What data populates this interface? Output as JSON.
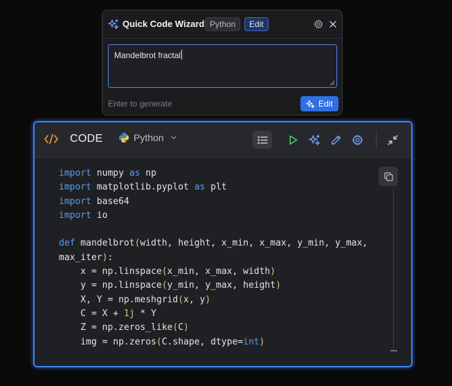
{
  "wizard": {
    "title": "Quick Code Wizard",
    "language_chip": "Python",
    "mode_chip": "Edit",
    "prompt_value": "Mandelbrot fractal",
    "hint": "Enter to generate",
    "generate_label": "Edit",
    "icons": [
      "sparkle-icon",
      "gear-icon",
      "close-icon"
    ]
  },
  "codeblock": {
    "title": "CODE",
    "language": "Python",
    "accent_color": "#3b82f6",
    "toolbar_icons": [
      "list-icon",
      "run-icon",
      "sparkle-icon",
      "pencil-icon",
      "gear-icon",
      "collapse-icon"
    ],
    "lines": [
      [
        [
          "kw",
          "import"
        ],
        [
          "t",
          " numpy "
        ],
        [
          "kw",
          "as"
        ],
        [
          "t",
          " np"
        ]
      ],
      [
        [
          "kw",
          "import"
        ],
        [
          "t",
          " matplotlib.pyplot "
        ],
        [
          "kw",
          "as"
        ],
        [
          "t",
          " plt"
        ]
      ],
      [
        [
          "kw",
          "import"
        ],
        [
          "t",
          " base64"
        ]
      ],
      [
        [
          "kw",
          "import"
        ],
        [
          "t",
          " io"
        ]
      ],
      [],
      [
        [
          "kw",
          "def"
        ],
        [
          "t",
          " mandelbrot"
        ],
        [
          "br",
          "("
        ],
        [
          "t",
          "width, height, x_min, x_max, y_min, y_max,"
        ]
      ],
      [
        [
          "t",
          "max_iter"
        ],
        [
          "br",
          ")"
        ],
        [
          "t",
          ":"
        ]
      ],
      [
        [
          "t",
          "    x = np.linspace"
        ],
        [
          "br",
          "("
        ],
        [
          "t",
          "x_min, x_max, width"
        ],
        [
          "br",
          ")"
        ]
      ],
      [
        [
          "t",
          "    y = np.linspace"
        ],
        [
          "br",
          "("
        ],
        [
          "t",
          "y_min, y_max, height"
        ],
        [
          "br",
          ")"
        ]
      ],
      [
        [
          "t",
          "    X, Y = np.meshgrid"
        ],
        [
          "br",
          "("
        ],
        [
          "t",
          "x, y"
        ],
        [
          "br",
          ")"
        ]
      ],
      [
        [
          "t",
          "    C = X + "
        ],
        [
          "num",
          "1j"
        ],
        [
          "t",
          " * Y"
        ]
      ],
      [
        [
          "t",
          "    Z = np.zeros_like"
        ],
        [
          "br",
          "("
        ],
        [
          "t",
          "C"
        ],
        [
          "br",
          ")"
        ]
      ],
      [
        [
          "t",
          "    img = np.zeros"
        ],
        [
          "br",
          "("
        ],
        [
          "t",
          "C.shape, dtype="
        ],
        [
          "kw",
          "int"
        ],
        [
          "br",
          ")"
        ]
      ]
    ]
  }
}
